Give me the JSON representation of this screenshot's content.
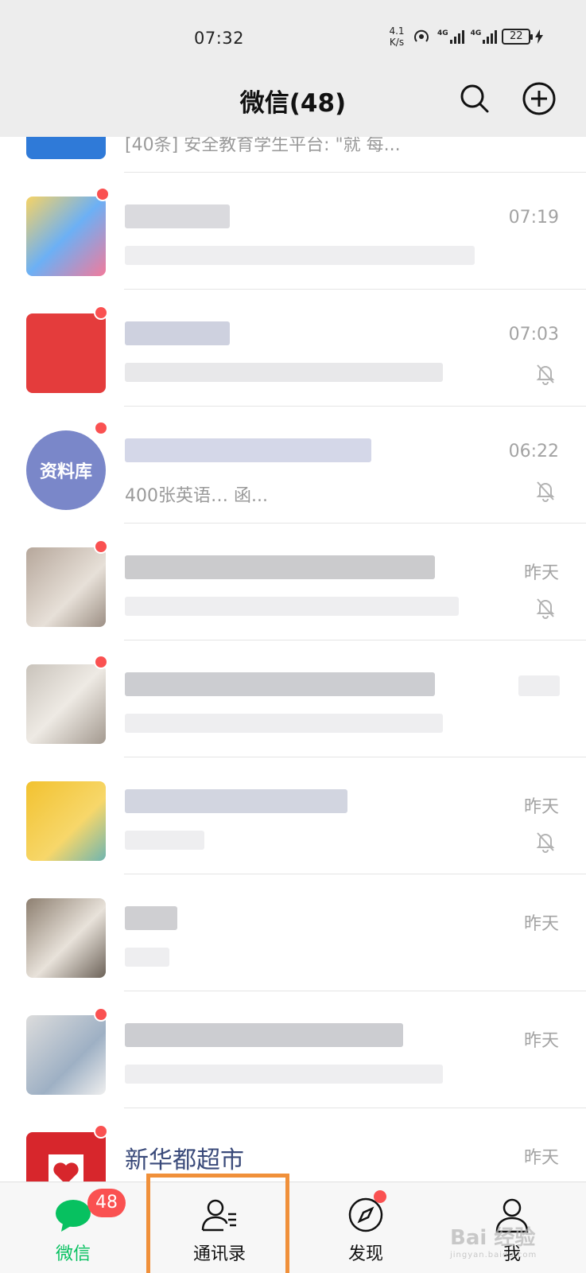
{
  "status_bar": {
    "time": "07:32",
    "net_speed_value": "4.1",
    "net_speed_unit": "K/s",
    "sim1_label": "4G",
    "sim2_label": "4G",
    "battery": "22"
  },
  "header": {
    "title": "微信(48)",
    "search_icon": "search-icon",
    "add_icon": "plus-circle-icon"
  },
  "chats": [
    {
      "name": "",
      "message": "[40条] 安全教育学生平台: \"就  每...",
      "time": "",
      "muted": false,
      "unread_dot": false,
      "avatar_color": "#2f7ad8"
    },
    {
      "name": "",
      "message": "",
      "time": "07:19",
      "muted": false,
      "unread_dot": true,
      "avatar_color": "#f4c05b"
    },
    {
      "name": "",
      "message": "",
      "time": "07:03",
      "muted": true,
      "unread_dot": true,
      "avatar_color": "#e43c3c"
    },
    {
      "name": "",
      "message": "400张英语…                    函...",
      "time": "06:22",
      "muted": true,
      "unread_dot": true,
      "avatar_color": "#7a87c9",
      "avatar_text": "资料库"
    },
    {
      "name": "",
      "message": "",
      "time": "昨天",
      "muted": true,
      "unread_dot": true,
      "avatar_color": "#b6a79b"
    },
    {
      "name": "",
      "message": "",
      "time": "",
      "muted": false,
      "unread_dot": true,
      "avatar_color": "#c9c3bb"
    },
    {
      "name": "",
      "message": "",
      "time": "昨天",
      "muted": true,
      "unread_dot": false,
      "avatar_color": "#f2c230"
    },
    {
      "name": "",
      "message": "",
      "time": "昨天",
      "muted": false,
      "unread_dot": false,
      "avatar_color": "#8d7f70"
    },
    {
      "name": "",
      "message": "",
      "time": "昨天",
      "muted": false,
      "unread_dot": true,
      "avatar_color": "#9eb0c4"
    },
    {
      "name": "新华都超市",
      "message": "",
      "time": "昨天",
      "muted": false,
      "unread_dot": true,
      "avatar_color": "#d7262c"
    }
  ],
  "tabs": [
    {
      "label": "微信",
      "icon": "chat-bubble-icon",
      "badge": "48",
      "active": true
    },
    {
      "label": "通讯录",
      "icon": "contacts-icon",
      "badge": "",
      "active": false
    },
    {
      "label": "发现",
      "icon": "compass-icon",
      "badge": "",
      "active": false,
      "dot": true
    },
    {
      "label": "我",
      "icon": "person-icon",
      "badge": "",
      "active": false
    }
  ],
  "watermark": "Bai 经验",
  "watermark_sub": "jingyan.baidu.com",
  "colors": {
    "accent": "#07c160",
    "badge": "#fa5151",
    "highlight": "#f0903a",
    "header_bg": "#ededed"
  }
}
